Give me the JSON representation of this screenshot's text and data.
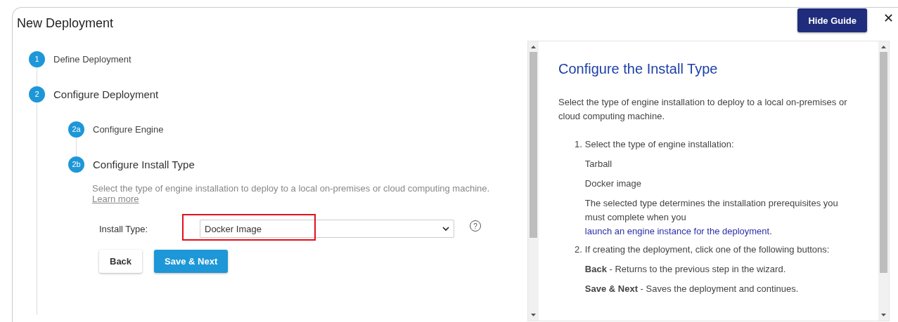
{
  "window": {
    "title": "New Deployment"
  },
  "header_buttons": {
    "hide_guide": "Hide Guide",
    "close": "✕"
  },
  "steps": [
    {
      "number": "1",
      "label": "Define Deployment",
      "selected": false
    },
    {
      "number": "2",
      "label": "Configure Deployment",
      "selected": true,
      "children": [
        {
          "number": "2a",
          "label": "Configure Engine",
          "selected": false
        },
        {
          "number": "2b",
          "label": "Configure Install Type",
          "selected": true
        }
      ]
    }
  ],
  "section": {
    "description": "Select the type of engine installation to deploy to a local on-premises or cloud computing machine.",
    "link": "Learn more"
  },
  "install_type": {
    "label": "Install Type:",
    "value": "Docker Image",
    "highlighted": true,
    "help": "?"
  },
  "buttons": [
    {
      "label": "Back",
      "kind": "secondary"
    },
    {
      "label": "Save & Next",
      "kind": "primary"
    }
  ],
  "guide": {
    "title": "Configure the Install Type",
    "intro": "Select the type of engine installation to deploy to a local on-premises or cloud computing machine.",
    "steps": [
      {
        "number": "1.",
        "text": "Select the type of engine installation:",
        "details": [
          {
            "text": "Tarball"
          },
          {
            "text": "Docker image"
          },
          {
            "text": "The selected type determines the installation prerequisites you must complete when you ",
            "link": "launch an engine instance for the deployment",
            "after": "."
          }
        ]
      },
      {
        "number": "2.",
        "text": "If creating the deployment, click one of the following buttons:",
        "details": [
          {
            "text": "**Back** - Returns to the previous step in the wizard."
          },
          {
            "text": "**Save & Next** - Saves the deployment and continues."
          }
        ]
      }
    ]
  }
}
